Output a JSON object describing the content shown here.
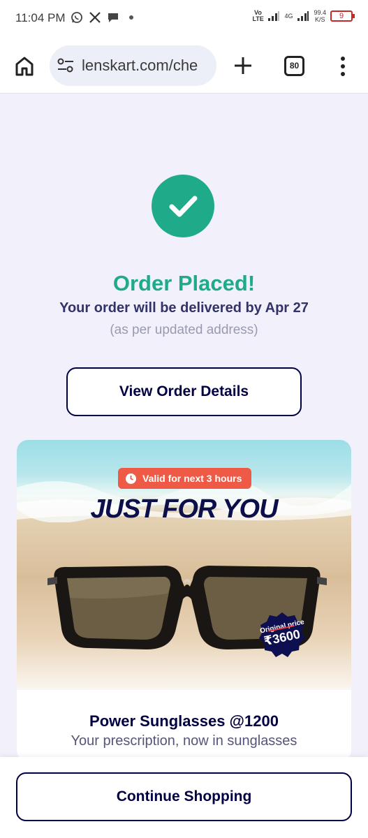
{
  "status_bar": {
    "time": "11:04 PM",
    "network_type": "Vo LTE",
    "data_type": "4G",
    "net_speed": "99.4",
    "net_speed_unit": "K/S",
    "battery_level": "9",
    "icons": [
      "whatsapp-icon",
      "x-icon",
      "chat-icon",
      "dot-icon",
      "signal-icon"
    ]
  },
  "browser": {
    "url": "lenskart.com/che",
    "tab_count": "80"
  },
  "confirmation": {
    "title": "Order Placed!",
    "subtitle": "Your order will be delivered by Apr 27",
    "note": "(as per updated address)",
    "view_order_label": "View Order Details",
    "accent_color": "#1fab89"
  },
  "promo": {
    "validity_badge": "Valid for next 3 hours",
    "headline": "JUST FOR YOU",
    "original_price_label": "Original price",
    "original_price": "₹3600",
    "title": "Power Sunglasses @1200",
    "subtitle": "Your prescription, now in sunglasses",
    "badge_color": "#ee5a45"
  },
  "footer": {
    "continue_label": "Continue Shopping"
  }
}
